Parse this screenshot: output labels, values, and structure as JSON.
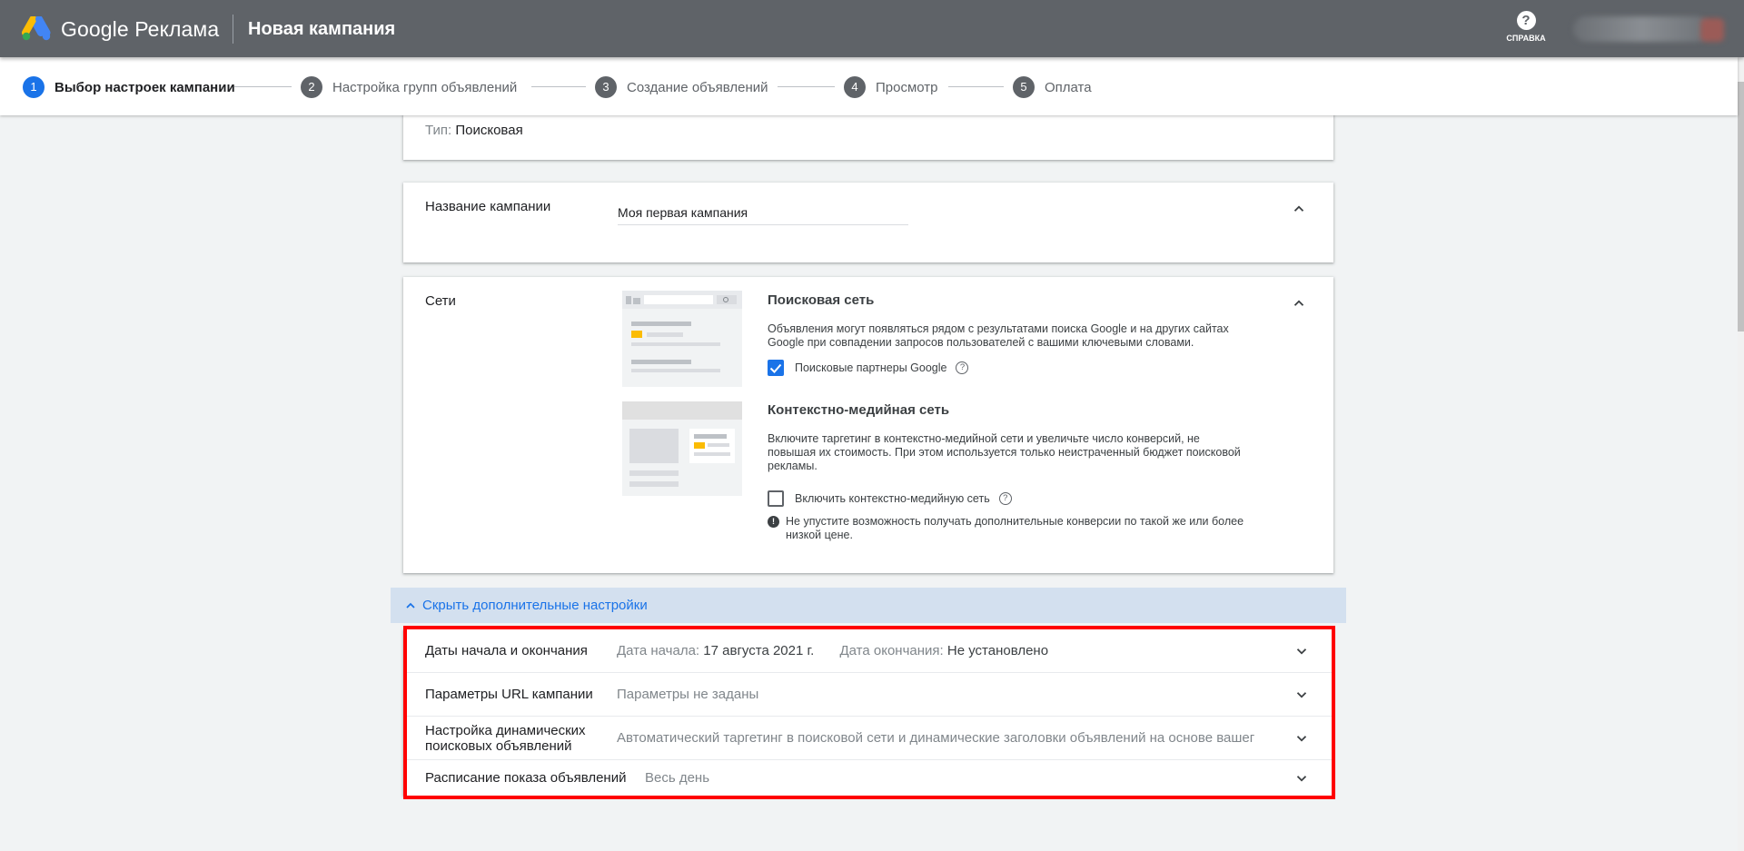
{
  "header": {
    "brand": "Google Реклама",
    "title": "Новая кампания",
    "help_label": "СПРАВКА"
  },
  "stepper": {
    "steps": [
      {
        "num": "1",
        "label": "Выбор настроек кампании"
      },
      {
        "num": "2",
        "label": "Настройка групп объявлений"
      },
      {
        "num": "3",
        "label": "Создание объявлений"
      },
      {
        "num": "4",
        "label": "Просмотр"
      },
      {
        "num": "5",
        "label": "Оплата"
      }
    ],
    "active_step": 1
  },
  "type_card": {
    "label": "Тип:",
    "value": "Поисковая"
  },
  "name_card": {
    "label": "Название кампании",
    "value": "Моя первая кампания"
  },
  "networks_card": {
    "label": "Сети",
    "search": {
      "title": "Поисковая сеть",
      "description": "Объявления могут появляться рядом с результатами поиска Google и на других сайтах Google при совпадении запросов пользователей с вашими ключевыми словами.",
      "checkbox_label": "Поисковые партнеры Google",
      "checked": true
    },
    "display": {
      "title": "Контекстно-медийная сеть",
      "description": "Включите таргетинг в контекстно-медийной сети и увеличьте число конверсий, не повышая их стоимость. При этом используется только неистраченный бюджет поисковой рекламы.",
      "checkbox_label": "Включить контекстно-медийную сеть",
      "checked": false,
      "note": "Не упустите возможность получать дополнительные конверсии по такой же или более низкой цене."
    }
  },
  "toggle": {
    "label": "Скрыть дополнительные настройки"
  },
  "advanced": {
    "dates": {
      "label": "Даты начала и окончания",
      "start_label": "Дата начала:",
      "start_value": "17 августа 2021 г.",
      "end_label": "Дата окончания:",
      "end_value": "Не установлено"
    },
    "url_params": {
      "label": "Параметры URL кампании",
      "value": "Параметры не заданы"
    },
    "dsa": {
      "label_line1": "Настройка динамических",
      "label_line2": "поисковых объявлений",
      "value": "Автоматический таргетинг в поисковой сети и динамические заголовки объявлений на основе вашег"
    },
    "schedule": {
      "label": "Расписание показа объявлений",
      "value": "Весь день"
    }
  },
  "colors": {
    "header_bg": "#5f6368",
    "accent": "#1a73e8",
    "highlight_frame": "#ff0000",
    "toggle_bg": "#d3e0ef"
  }
}
